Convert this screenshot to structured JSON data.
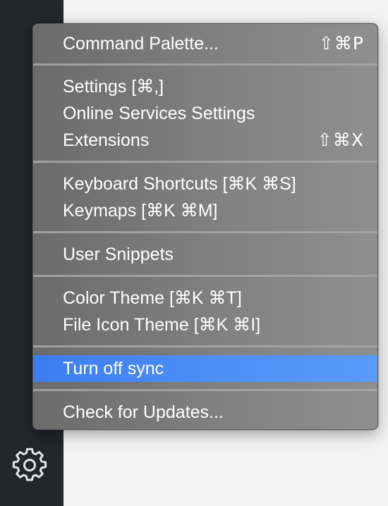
{
  "colors": {
    "activity_bar": "#22272d",
    "menu_background": "#7a7a7a",
    "highlight": "#4a8cf4",
    "menu_text": "#ffffff"
  },
  "activity_bar": {
    "manage_icon": "gear-icon"
  },
  "menu": {
    "items": [
      {
        "label": "Command Palette...",
        "shortcut": "⇧⌘P"
      },
      {
        "label": "Settings [⌘,]",
        "shortcut": ""
      },
      {
        "label": "Online Services Settings",
        "shortcut": ""
      },
      {
        "label": "Extensions",
        "shortcut": "⇧⌘X"
      },
      {
        "label": "Keyboard Shortcuts [⌘K ⌘S]",
        "shortcut": ""
      },
      {
        "label": "Keymaps [⌘K ⌘M]",
        "shortcut": ""
      },
      {
        "label": "User Snippets",
        "shortcut": ""
      },
      {
        "label": "Color Theme [⌘K ⌘T]",
        "shortcut": ""
      },
      {
        "label": "File Icon Theme [⌘K ⌘I]",
        "shortcut": ""
      },
      {
        "label": "Turn off sync",
        "shortcut": "",
        "highlighted": true
      },
      {
        "label": "Check for Updates...",
        "shortcut": ""
      }
    ]
  }
}
